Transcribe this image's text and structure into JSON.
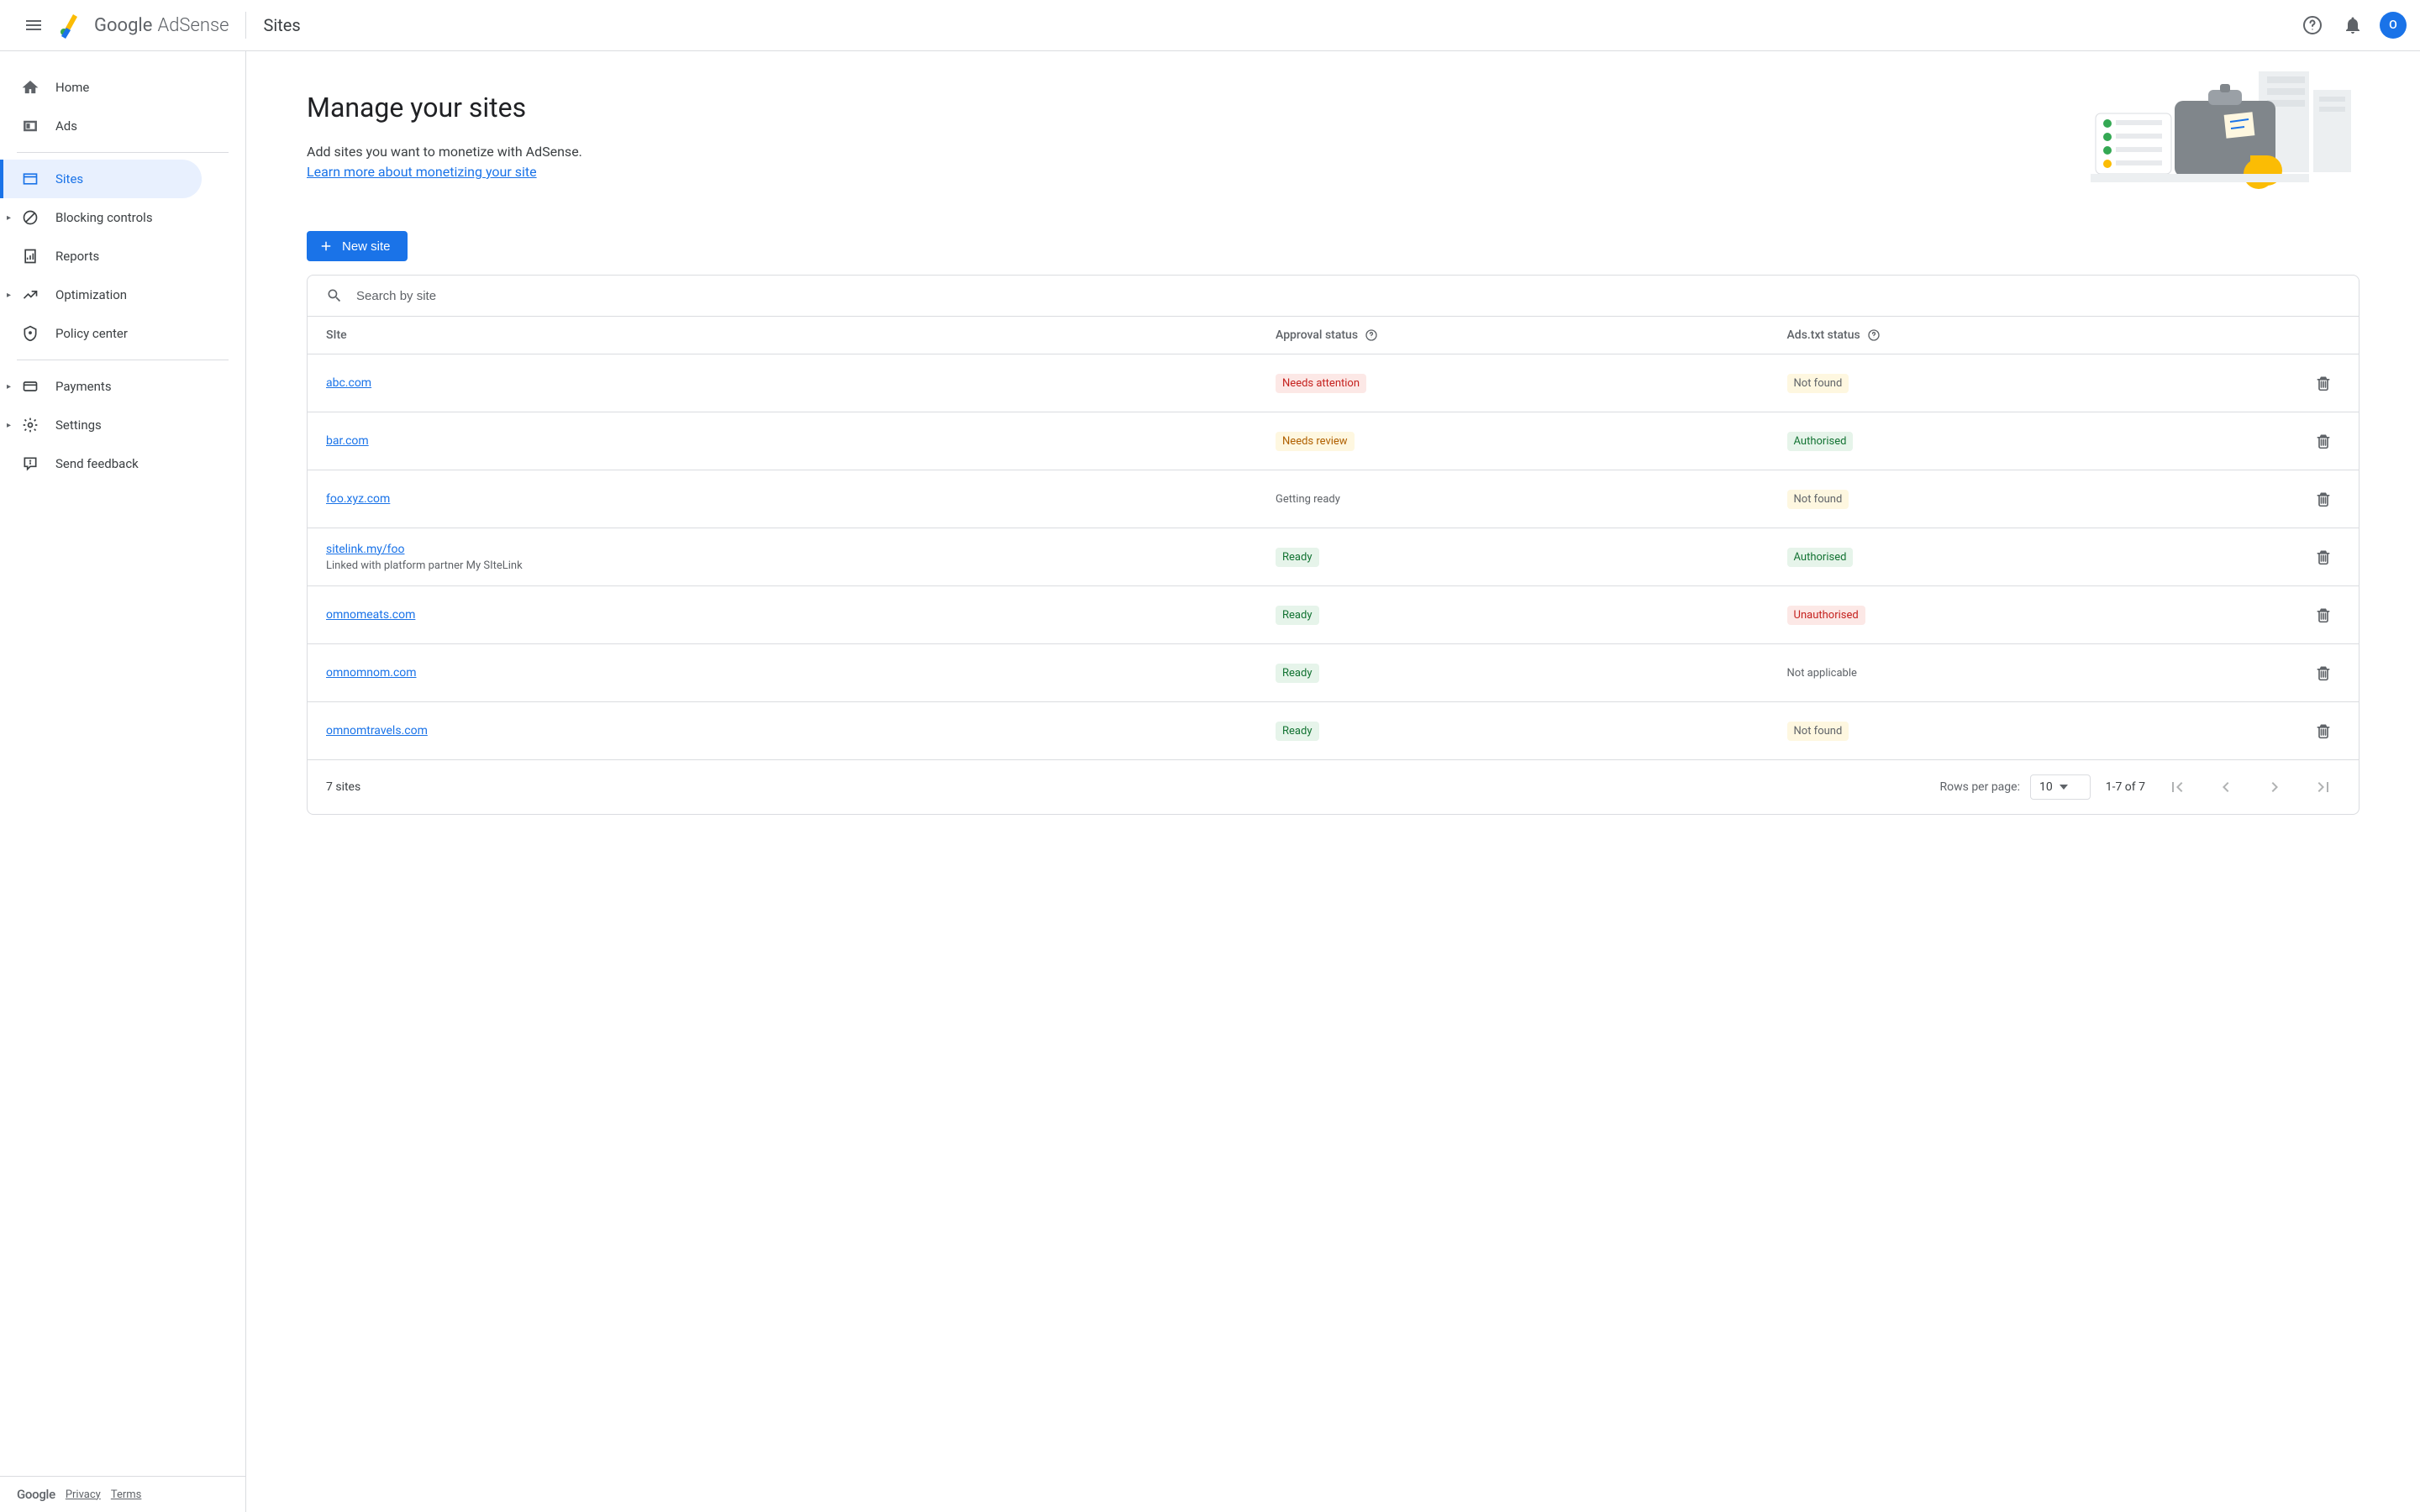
{
  "header": {
    "product_google": "Google",
    "product_name": "AdSense",
    "page_context": "Sites",
    "avatar_letter": "O"
  },
  "sidebar": {
    "items": [
      {
        "label": "Home"
      },
      {
        "label": "Ads"
      },
      {
        "label": "Sites"
      },
      {
        "label": "Blocking controls"
      },
      {
        "label": "Reports"
      },
      {
        "label": "Optimization"
      },
      {
        "label": "Policy center"
      },
      {
        "label": "Payments"
      },
      {
        "label": "Settings"
      },
      {
        "label": "Send feedback"
      }
    ],
    "footer": {
      "brand": "Google",
      "privacy": "Privacy",
      "terms": "Terms"
    }
  },
  "main": {
    "title": "Manage your sites",
    "subtitle": "Add sites you want to monetize with AdSense.",
    "learn_more": "Learn more about monetizing your site",
    "new_site_label": "New site",
    "search_placeholder": "Search by site",
    "columns": {
      "site": "SIte",
      "approval": "Approval status",
      "adstxt": "Ads.txt status"
    },
    "rows": [
      {
        "site": "abc.com",
        "approval": "Needs attention",
        "approval_style": "red",
        "adstxt": "Not found",
        "adstxt_style": "yellow-light"
      },
      {
        "site": "bar.com",
        "approval": "Needs review",
        "approval_style": "yellow",
        "adstxt": "Authorised",
        "adstxt_style": "green"
      },
      {
        "site": "foo.xyz.com",
        "approval": "Getting ready",
        "approval_style": "plain",
        "adstxt": "Not found",
        "adstxt_style": "yellow-light"
      },
      {
        "site": "sitelink.my/foo",
        "subtitle": "Linked with platform partner My SIteLink",
        "approval": "Ready",
        "approval_style": "green",
        "adstxt": "Authorised",
        "adstxt_style": "green"
      },
      {
        "site": "omnomeats.com",
        "approval": "Ready",
        "approval_style": "green",
        "adstxt": "Unauthorised",
        "adstxt_style": "red"
      },
      {
        "site": "omnomnom.com",
        "approval": "Ready",
        "approval_style": "green",
        "adstxt": "Not applicable",
        "adstxt_style": "plain"
      },
      {
        "site": "omnomtravels.com",
        "approval": "Ready",
        "approval_style": "green",
        "adstxt": "Not found",
        "adstxt_style": "yellow-light"
      }
    ],
    "footer": {
      "count": "7 sites",
      "rows_per_page_label": "Rows per page:",
      "rows_per_page_value": "10",
      "range": "1-7 of 7"
    }
  }
}
